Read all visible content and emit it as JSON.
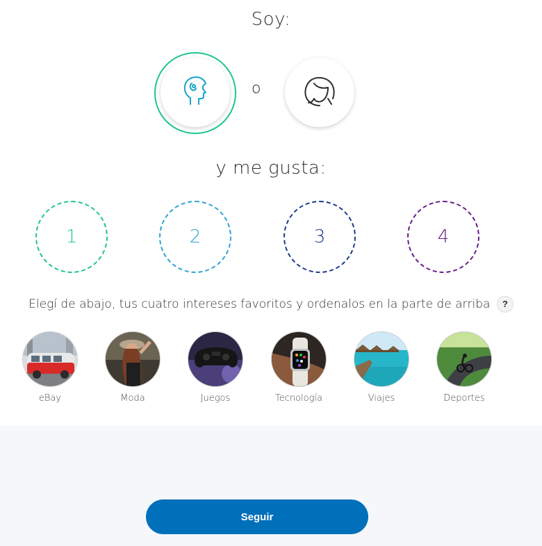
{
  "gender": {
    "title": "Soy:",
    "or_label": "o",
    "options": [
      {
        "id": "male",
        "icon": "male-head-icon",
        "selected": true
      },
      {
        "id": "female",
        "icon": "female-head-icon",
        "selected": false
      }
    ]
  },
  "likes": {
    "title": "y me gusta:",
    "slots": [
      "1",
      "2",
      "3",
      "4"
    ],
    "slot_colors": [
      "#1fc493",
      "#2ba3d4",
      "#1a3a8a",
      "#6b1a8a"
    ]
  },
  "instruction": "Elegí de abajo, tus cuatro intereses favoritos y ordenalos en la parte de arriba",
  "help_label": "?",
  "interests": [
    {
      "label": "eBay"
    },
    {
      "label": "Moda"
    },
    {
      "label": "Juegos"
    },
    {
      "label": "Tecnología"
    },
    {
      "label": "Viajes"
    },
    {
      "label": "Deportes"
    }
  ],
  "footer": {
    "continue_label": "Seguir"
  },
  "colors": {
    "accent": "#1fc493",
    "primary_button": "#0070ba",
    "footer_bg": "#f5f7fa"
  }
}
